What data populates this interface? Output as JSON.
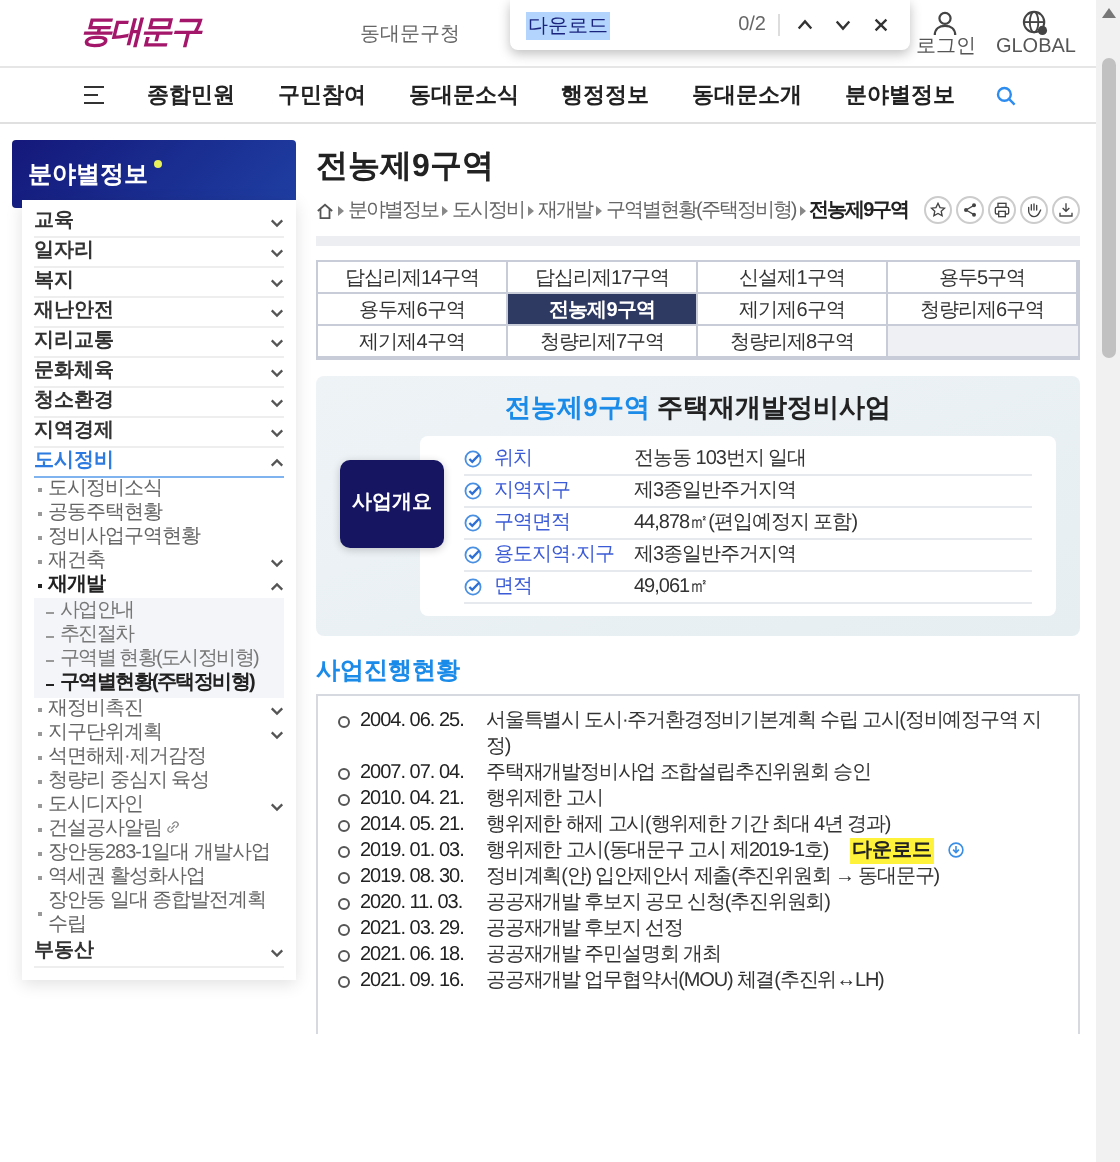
{
  "header": {
    "logo": "동대문구",
    "office_link": "동대문구청",
    "find_bar": {
      "query": "다운로드",
      "match_count": "0/2"
    },
    "utility": [
      {
        "kind": "person",
        "label": "로그인"
      },
      {
        "kind": "globe",
        "label": "GLOBAL"
      }
    ]
  },
  "nav": {
    "items": [
      "종합민원",
      "구민참여",
      "동대문소식",
      "행정정보",
      "동대문소개",
      "분야별정보"
    ]
  },
  "sidebar": {
    "title": "분야별정보",
    "items": [
      {
        "label": "교육",
        "expanded": false
      },
      {
        "label": "일자리",
        "expanded": false
      },
      {
        "label": "복지",
        "expanded": false
      },
      {
        "label": "재난안전",
        "expanded": false
      },
      {
        "label": "지리교통",
        "expanded": false
      },
      {
        "label": "문화체육",
        "expanded": false
      },
      {
        "label": "청소환경",
        "expanded": false
      },
      {
        "label": "지역경제",
        "expanded": false
      },
      {
        "label": "도시정비",
        "expanded": true,
        "children": [
          {
            "label": "도시정비소식",
            "kind": "link"
          },
          {
            "label": "공동주택현황",
            "kind": "link"
          },
          {
            "label": "정비사업구역현황",
            "kind": "link"
          },
          {
            "label": "재건축",
            "kind": "folder",
            "expanded": false
          },
          {
            "label": "재개발",
            "kind": "folder",
            "expanded": true,
            "children": [
              {
                "label": "사업안내",
                "selected": false
              },
              {
                "label": "추진절차",
                "selected": false
              },
              {
                "label": "구역별 현황(도시정비형)",
                "selected": false
              },
              {
                "label": "구역별현황(주택정비형)",
                "selected": true
              }
            ]
          },
          {
            "label": "재정비촉진",
            "kind": "folder",
            "expanded": false
          },
          {
            "label": "지구단위계획",
            "kind": "folder",
            "expanded": false
          },
          {
            "label": "석면해체·제거감정",
            "kind": "link"
          },
          {
            "label": "청량리 중심지 육성",
            "kind": "link"
          },
          {
            "label": "도시디자인",
            "kind": "folder",
            "expanded": false
          },
          {
            "label": "건설공사알림",
            "kind": "external"
          },
          {
            "label": "장안동283-1일대 개발사업",
            "kind": "link"
          },
          {
            "label": "역세권 활성화사업",
            "kind": "link"
          },
          {
            "label": "장안동 일대 종합발전계획 수립",
            "kind": "link"
          }
        ]
      },
      {
        "label": "부동산",
        "expanded": false
      }
    ]
  },
  "main": {
    "title": "전농제9구역",
    "breadcrumb": [
      "분야별정보",
      "도시정비",
      "재개발",
      "구역별현황(주택정비형)",
      "전농제9구역"
    ],
    "actions": [
      {
        "kind": "star"
      },
      {
        "kind": "share"
      },
      {
        "kind": "print"
      },
      {
        "kind": "hand"
      },
      {
        "kind": "download"
      }
    ],
    "tabs": [
      {
        "label": "답십리제14구역",
        "selected": false
      },
      {
        "label": "답십리제17구역",
        "selected": false
      },
      {
        "label": "신설제1구역",
        "selected": false
      },
      {
        "label": "용두5구역",
        "selected": false
      },
      {
        "label": "용두제6구역",
        "selected": false
      },
      {
        "label": "전농제9구역",
        "selected": true
      },
      {
        "label": "제기제6구역",
        "selected": false
      },
      {
        "label": "청량리제6구역",
        "selected": false
      },
      {
        "label": "제기제4구역",
        "selected": false
      },
      {
        "label": "청량리제7구역",
        "selected": false
      },
      {
        "label": "청량리제8구역",
        "selected": false
      }
    ],
    "overview": {
      "title_highlight": "전농제9구역",
      "title_rest": "주택재개발정비사업",
      "badge": "사업개요",
      "rows": [
        {
          "label": "위치",
          "value": "전농동 103번지 일대"
        },
        {
          "label": "지역지구",
          "value": "제3종일반주거지역"
        },
        {
          "label": "구역면적",
          "value": "44,878㎡(편입예정지 포함)"
        },
        {
          "label": "용도지역·지구",
          "value": "제3종일반주거지역"
        },
        {
          "label": "면적",
          "value": "49,061㎡"
        }
      ]
    },
    "progress": {
      "title": "사업진행현황",
      "events": [
        {
          "date": "2004. 06. 25.",
          "text": "서울특별시 도시·주거환경정비기본계획 수립 고시(정비예정구역 지정)"
        },
        {
          "date": "2007. 07. 04.",
          "text": "주택재개발정비사업 조합설립추진위원회 승인"
        },
        {
          "date": "2010. 04. 21.",
          "text": "행위제한 고시"
        },
        {
          "date": "2014. 05. 21.",
          "text": "행위제한 해제 고시(행위제한 기간 최대 4년 경과)"
        },
        {
          "date": "2019. 01. 03.",
          "text": "행위제한 고시(동대문구 고시 제2019-1호)",
          "download": {
            "label": "다운로드",
            "highlighted": true
          }
        },
        {
          "date": "2019. 08. 30.",
          "text": "정비계획(안) 입안제안서 제출(추진위원회 → 동대문구)"
        },
        {
          "date": "2020. 11. 03.",
          "text": "공공재개발 후보지 공모 신청(추진위원회)"
        },
        {
          "date": "2021. 03. 29.",
          "text": "공공재개발 후보지 선정"
        },
        {
          "date": "2021. 06. 18.",
          "text": "공공재개발 주민설명회 개최"
        },
        {
          "date": "2021. 09. 16.",
          "text": "공공재개발 업무협약서(MOU) 체결(추진위↔LH)"
        }
      ]
    }
  }
}
